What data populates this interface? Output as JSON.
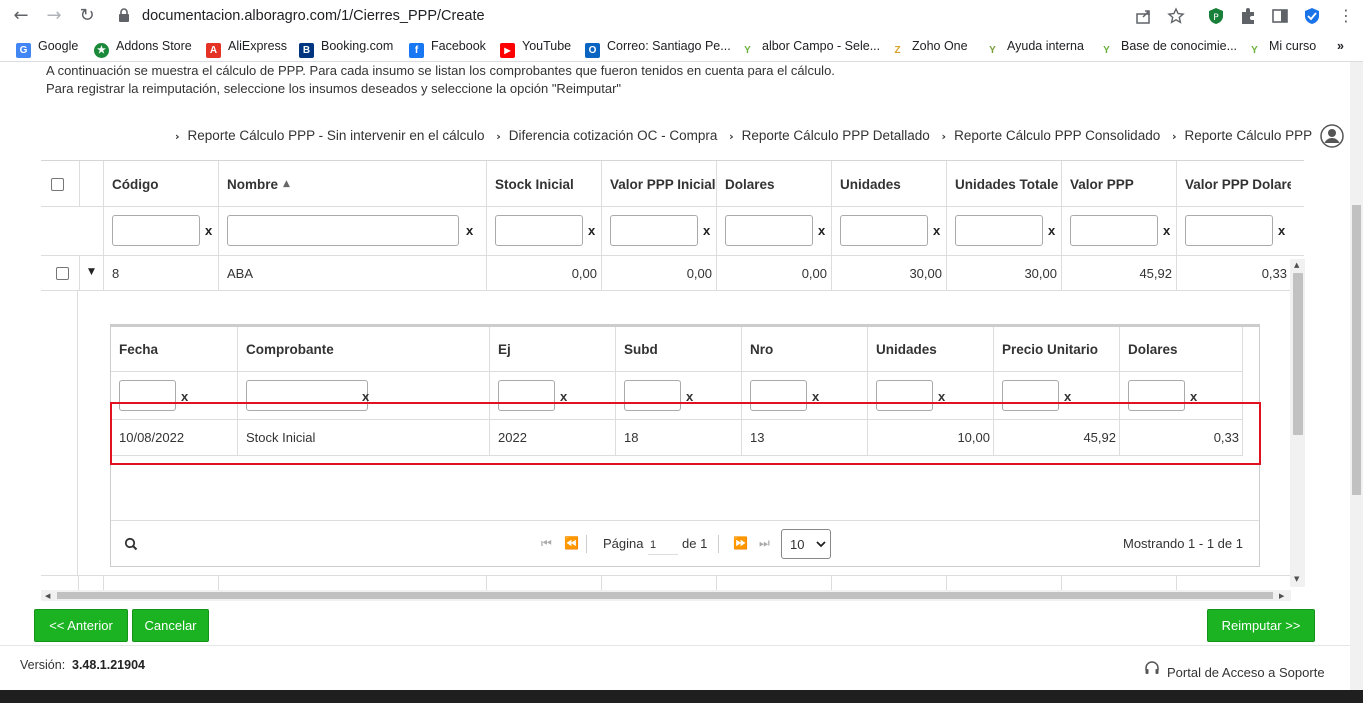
{
  "browser": {
    "url": "documentacion.alboragro.com/1/Cierres_PPP/Create",
    "bookmarks": [
      {
        "label": "Google",
        "color": "#4285f4",
        "glyph": "G"
      },
      {
        "label": "Addons Store",
        "color": "#1a8a3a",
        "glyph": "★"
      },
      {
        "label": "AliExpress",
        "color": "#e43225",
        "glyph": "A"
      },
      {
        "label": "Booking.com",
        "color": "#003580",
        "glyph": "B"
      },
      {
        "label": "Facebook",
        "color": "#1877f2",
        "glyph": "f"
      },
      {
        "label": "YouTube",
        "color": "#ff0000",
        "glyph": "▶"
      },
      {
        "label": "Correo: Santiago Pe...",
        "color": "#0a64c2",
        "glyph": "O"
      },
      {
        "label": "albor Campo - Sele...",
        "color": "#6bb23a",
        "glyph": "Y"
      },
      {
        "label": "Zoho One",
        "color": "#d8a32a",
        "glyph": "Z"
      },
      {
        "label": "Ayuda interna",
        "color": "#7a9e3a",
        "glyph": "Y"
      },
      {
        "label": "Base de conocimie...",
        "color": "#6bb23a",
        "glyph": "Y"
      },
      {
        "label": "Mi curso",
        "color": "#6bb23a",
        "glyph": "Y"
      }
    ],
    "more": "»"
  },
  "intro": {
    "line1": "A continuación se muestra el cálculo de PPP. Para cada insumo se listan los comprobantes que fueron tenidos en cuenta para el cálculo.",
    "line2": "Para registrar la reimputación, seleccione los insumos deseados y seleccione la opción \"Reimputar\""
  },
  "reports": [
    "Reporte Cálculo PPP - Sin intervenir en el cálculo",
    "Diferencia cotización OC - Compra",
    "Reporte Cálculo PPP Detallado",
    "Reporte Cálculo PPP Consolidado",
    "Reporte Cálculo PPP"
  ],
  "grid": {
    "columns": [
      "Código",
      "Nombre",
      "Stock Inicial",
      "Valor PPP Inicial",
      "Dolares",
      "Unidades",
      "Unidades Totale",
      "Valor PPP",
      "Valor PPP Dolare"
    ],
    "filter_clear": "x",
    "row": {
      "codigo": "8",
      "nombre": "ABA",
      "stock_inicial": "0,00",
      "valor_ppp_inicial": "0,00",
      "dolares": "0,00",
      "unidades": "30,00",
      "unidades_totales": "30,00",
      "valor_ppp": "45,92",
      "valor_ppp_dolares": "0,33"
    }
  },
  "subgrid": {
    "columns": [
      "Fecha",
      "Comprobante",
      "Ej",
      "Subd",
      "Nro",
      "Unidades",
      "Precio Unitario",
      "Dolares"
    ],
    "filter_clear": "x",
    "row": {
      "fecha": "10/08/2022",
      "comprobante": "Stock Inicial",
      "ej": "2022",
      "subd": "18",
      "nro": "13",
      "unidades": "10,00",
      "precio_unitario": "45,92",
      "dolares": "0,33"
    },
    "pager": {
      "page_label": "Página",
      "page_value": "1",
      "of_label": "de 1",
      "page_size": "10",
      "showing": "Mostrando 1 - 1 de 1"
    }
  },
  "buttons": {
    "prev": "<< Anterior",
    "cancel": "Cancelar",
    "reimputar": "Reimputar >>"
  },
  "footer": {
    "version_label": "Versión:",
    "version_value": "3.48.1.21904",
    "support": "Portal de Acceso a Soporte"
  },
  "colors": {
    "accent_green": "#1bb321",
    "highlight_red": "#e0121f"
  }
}
